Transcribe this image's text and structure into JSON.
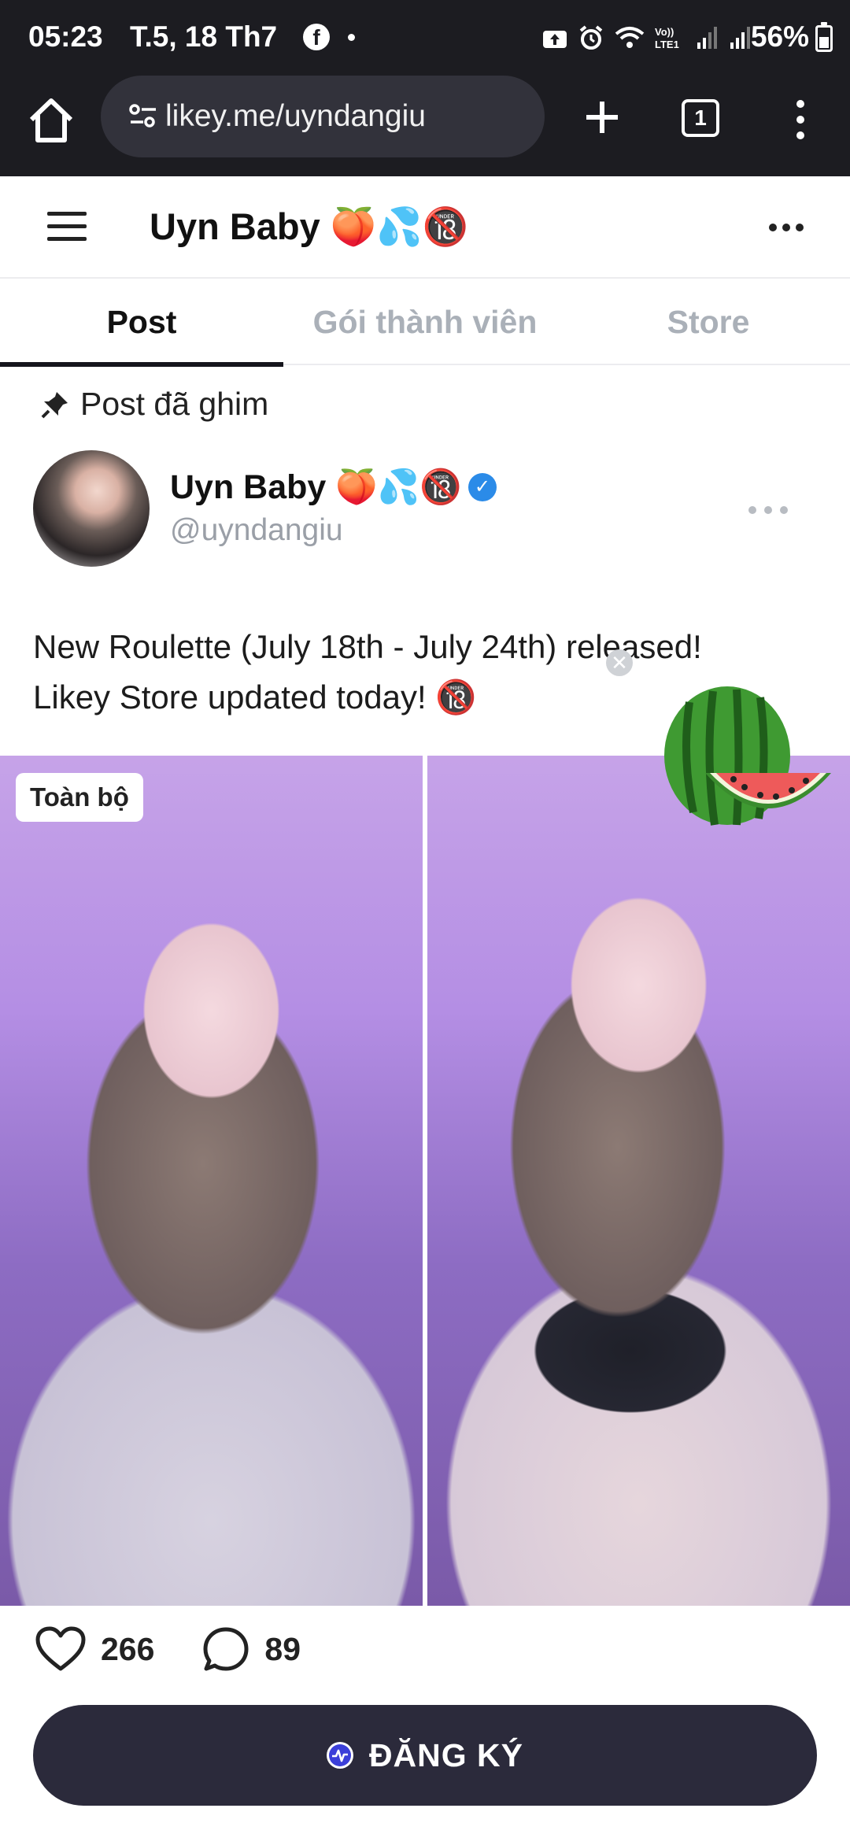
{
  "status_bar": {
    "time": "05:23",
    "date": "T.5, 18 Th7",
    "battery": "56%",
    "network_label": "Vo)) LTE1"
  },
  "browser": {
    "url": "likey.me/uyndangiu",
    "tab_count": "1"
  },
  "header": {
    "title": "Uyn Baby 🍑💦🔞"
  },
  "tabs": [
    {
      "label": "Post",
      "active": true
    },
    {
      "label": "Gói thành viên",
      "active": false
    },
    {
      "label": "Store",
      "active": false
    }
  ],
  "post": {
    "pinned_label": "Post đã ghim",
    "author_name": "Uyn Baby 🍑💦🔞",
    "author_handle": "@uyndangiu",
    "text_line1": "New Roulette (July 18th - July 24th) released!",
    "text_line2": "Likey Store updated today! 🔞",
    "gallery_badge": "Toàn bộ",
    "likes": "266",
    "comments": "89"
  },
  "subscribe": {
    "label": "ĐĂNG KÝ"
  },
  "colors": {
    "chrome_bg": "#1c1c21",
    "button_bg": "#2b2a3b",
    "verified_blue": "#2b8be8",
    "inactive_tab": "#aab0b8"
  }
}
